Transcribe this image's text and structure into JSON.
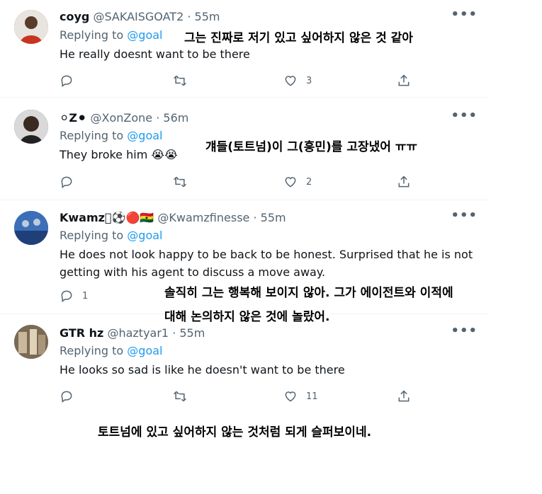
{
  "tweets": [
    {
      "name": "coyg",
      "handle": "@SAKAISGOAT2",
      "time": "55m",
      "replying_prefix": "Replying to",
      "replying_to": "@goal",
      "text": "He really doesnt want to be there",
      "replies": "",
      "likes": "3",
      "avatar_color": "#c8341f"
    },
    {
      "name": "⚪Z⚫",
      "handle": "@XonZone",
      "time": "56m",
      "replying_prefix": "Replying to",
      "replying_to": "@goal",
      "text": "They broke him 😭😭",
      "replies": "",
      "likes": "2",
      "avatar_color": "#2b2b2b"
    },
    {
      "name": "Kwamz🏾⚽🔴🇬🇭",
      "handle": "@Kwamzfinesse",
      "time": "55m",
      "replying_prefix": "Replying to",
      "replying_to": "@goal",
      "text_line1": "He does not look happy to be back to be honest. Surprised that he is not",
      "text_line2": "getting with his agent to discuss a move away.",
      "replies": "1",
      "likes": "",
      "avatar_color": "#2f5fa8"
    },
    {
      "name": "GTR hz",
      "handle": "@haztyar1",
      "time": "55m",
      "replying_prefix": "Replying to",
      "replying_to": "@goal",
      "text": "He looks so sad is like he doesn't want to be there",
      "replies": "",
      "likes": "11",
      "avatar_color": "#6b5a44"
    }
  ],
  "captions": {
    "c1": "그는 진짜로 저기 있고 싶어하지 않은 것 같아",
    "c2": "걔들(토트넘)이 그(흥민)를 고장냈어 ㅠㅠ",
    "c3_line1": "솔직히 그는 행복해 보이지 않아. 그가 에이전트와 이적에",
    "c3_line2": "대해 논의하지 않은 것에 놀랐어.",
    "c4": "토트넘에 있고 싶어하지 않는 것처럼 되게 슬퍼보이네."
  },
  "icons": [
    "reply-icon",
    "retweet-icon",
    "like-icon",
    "share-icon",
    "more-icon"
  ],
  "colors": {
    "link": "#1d9bf0",
    "secondary": "#536471",
    "text": "#0f1419"
  }
}
